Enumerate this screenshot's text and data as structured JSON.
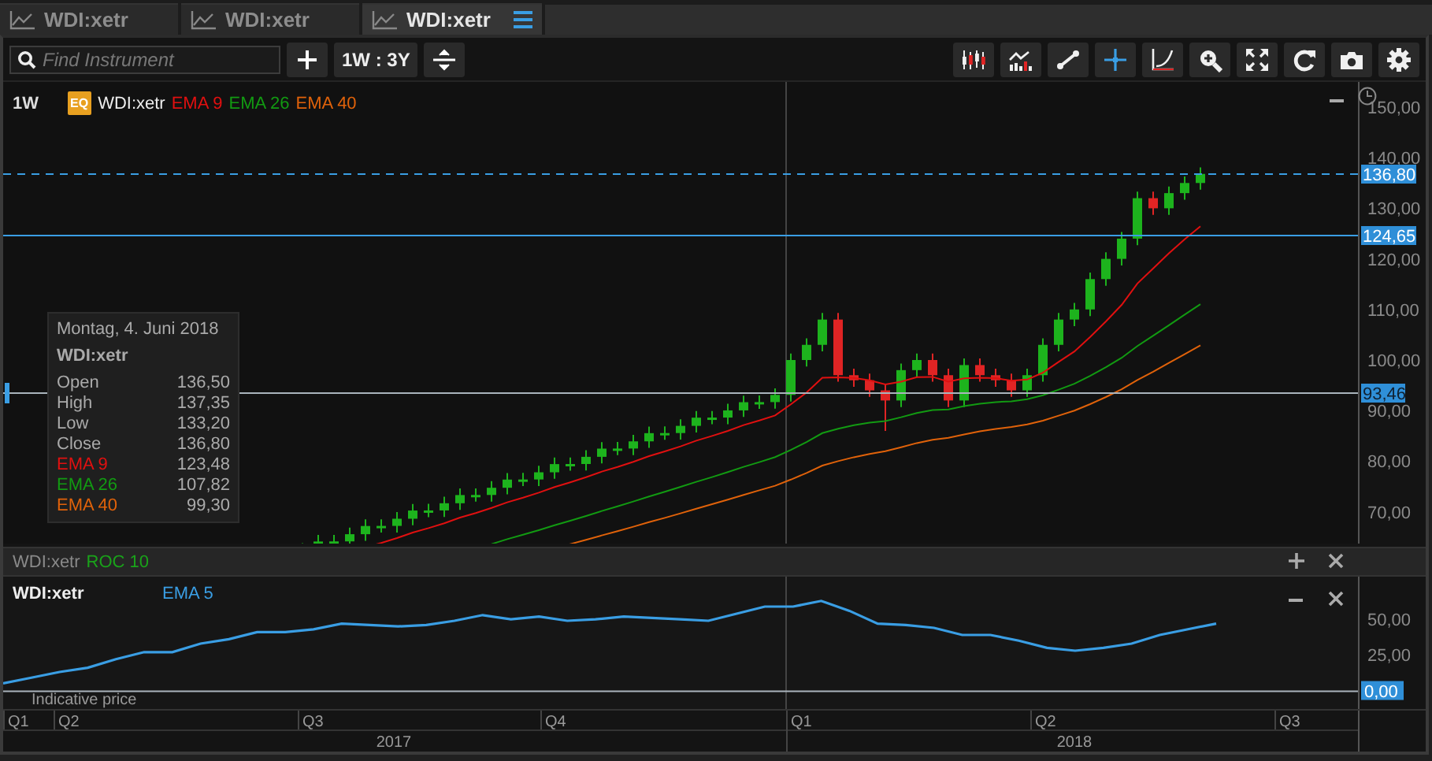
{
  "tabs": [
    {
      "label": "WDI:xetr",
      "selected": false
    },
    {
      "label": "WDI:xetr",
      "selected": false
    },
    {
      "label": "WDI:xetr",
      "selected": true
    }
  ],
  "toolbar": {
    "search": {
      "placeholder": "Find Instrument"
    },
    "period": "1W : 3Y",
    "tools": [
      {
        "kind": "candles",
        "selected": false
      },
      {
        "kind": "indicators",
        "selected": false
      },
      {
        "kind": "line",
        "selected": false
      },
      {
        "kind": "crosshair",
        "selected": true
      },
      {
        "kind": "curve",
        "selected": false
      },
      {
        "kind": "zoom",
        "selected": false
      },
      {
        "kind": "fullscreen",
        "selected": false
      },
      {
        "kind": "reload",
        "selected": false
      },
      {
        "kind": "camera",
        "selected": false
      },
      {
        "kind": "settings",
        "selected": false
      }
    ]
  },
  "price_chart": {
    "interval": "1W",
    "instrument": {
      "badge": "EQ",
      "name": "WDI:xetr"
    },
    "studies": [
      {
        "label": "EMA 9",
        "color": "#e01010"
      },
      {
        "label": "EMA 26",
        "color": "#129a12"
      },
      {
        "label": "EMA 40",
        "color": "#e0620a"
      }
    ],
    "axis_labels": [
      "150,00",
      "140,00",
      "130,00",
      "120,00",
      "110,00",
      "100,00",
      "90,00",
      "80,00",
      "70,00"
    ],
    "markers": [
      {
        "label": "136,80",
        "kind": "dashed"
      },
      {
        "label": "124,65",
        "kind": "solid"
      },
      {
        "label": "93,46",
        "kind": "crosshair"
      }
    ],
    "tooltip": {
      "date": "Montag, 4. Juni 2018",
      "instrument": "WDI:xetr",
      "rows": [
        {
          "label": "Open",
          "value": "136,50"
        },
        {
          "label": "High",
          "value": "137,35"
        },
        {
          "label": "Low",
          "value": "133,20"
        },
        {
          "label": "Close",
          "value": "136,80"
        },
        {
          "label": "EMA 9",
          "value": "123,48",
          "color": "#e01010"
        },
        {
          "label": "EMA 26",
          "value": "107,82",
          "color": "#129a12"
        },
        {
          "label": "EMA 40",
          "value": "99,30",
          "color": "#e0620a"
        }
      ]
    }
  },
  "indicator_panel": {
    "instrument": "WDI:xetr",
    "study": "ROC 10",
    "legend": {
      "instrument": "WDI:xetr"
    },
    "note": "Indicative price",
    "chart_data": {
      "type": "line",
      "ylim": [
        -13,
        80
      ],
      "categories": [
        null,
        null,
        null,
        null,
        null,
        null,
        null,
        null,
        null,
        null,
        null,
        null,
        null,
        null,
        null,
        null,
        null,
        null,
        null,
        null,
        null,
        null,
        null,
        null,
        null,
        null,
        null,
        null,
        null,
        null,
        null,
        null,
        null,
        null,
        null,
        null,
        null,
        null,
        null,
        null,
        null,
        null,
        null,
        null
      ],
      "yticks": [
        {
          "value": 0,
          "label": "0,00"
        },
        {
          "value": 25,
          "label": "25,00"
        },
        {
          "value": 50,
          "label": "50,00"
        }
      ],
      "series": [
        {
          "name": "EMA 5",
          "color": "#3a9ee4",
          "values": [
            5,
            9,
            13,
            16,
            22,
            27,
            27,
            33,
            36,
            41,
            41,
            43,
            47,
            46,
            45,
            46,
            49,
            53,
            50,
            52,
            49,
            50,
            52,
            51,
            50,
            49,
            54,
            59,
            59,
            63,
            56,
            47,
            46,
            44,
            39,
            39,
            35,
            30,
            28,
            30,
            33,
            39,
            43,
            47
          ]
        }
      ]
    }
  },
  "time_axis": {
    "quarters": [
      "Q1",
      "Q2",
      "Q3",
      "Q4",
      "Q1",
      "Q2",
      "Q3"
    ],
    "years": [
      "2017",
      "2018"
    ]
  }
}
